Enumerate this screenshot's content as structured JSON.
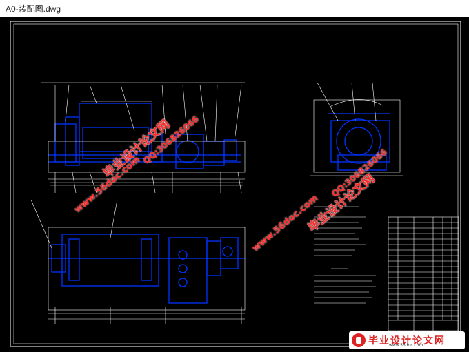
{
  "window": {
    "title": "A0-装配图.dwg"
  },
  "watermarks": {
    "site_name": "毕业设计论文网",
    "site_url": "www.56doc.com",
    "qq": "QQ:306826066"
  },
  "logo": {
    "text": "毕业设计论文网",
    "url": "www.56doc.com"
  },
  "colors": {
    "drawing": "#0033ff",
    "lines": "#ffffff",
    "background": "#000000",
    "watermark": "#ff2a2a"
  }
}
